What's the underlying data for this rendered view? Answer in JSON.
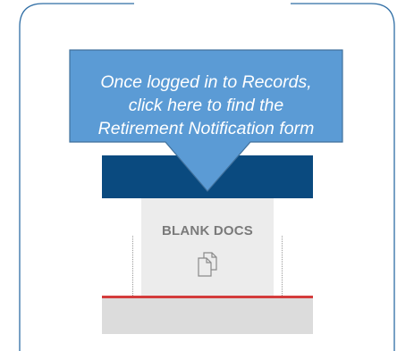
{
  "callout": {
    "text": "Once logged in to Records,\nclick here to find the\nRetirement Notification form"
  },
  "tab": {
    "label": "BLANK DOCS",
    "icon": "documents-icon"
  },
  "colors": {
    "callout_fill": "#5b9bd5",
    "callout_border": "#41719c",
    "nav_bar": "#0a4a7f",
    "tab_background": "#ececec",
    "tab_text": "#7a7a7a",
    "active_underline": "#d43c3c",
    "frame_border": "#2e6da4"
  }
}
